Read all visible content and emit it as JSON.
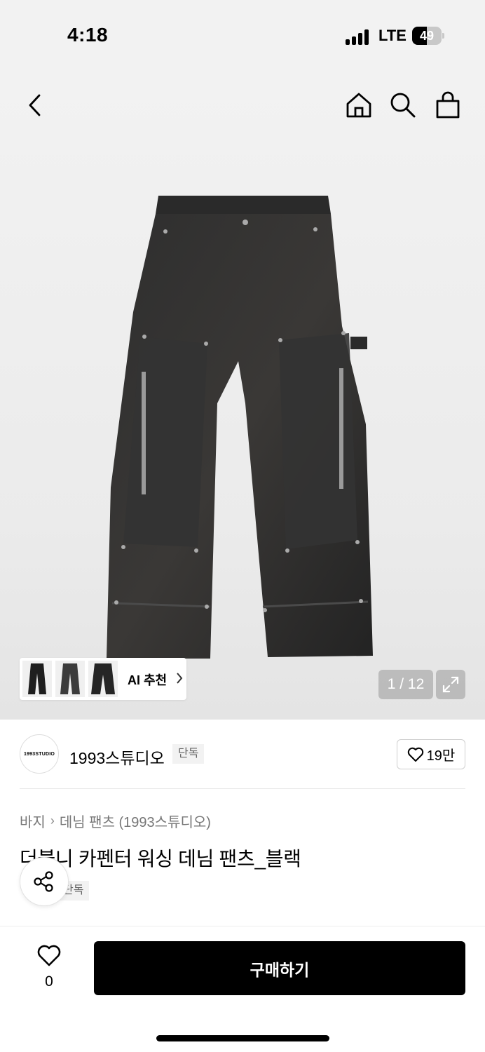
{
  "status": {
    "time": "4:18",
    "network": "LTE",
    "battery": "49",
    "battery_level": 0.49
  },
  "nav": {
    "back_icon": "chevron-left-icon",
    "home_icon": "home-icon",
    "search_icon": "search-icon",
    "cart_icon": "shopping-bag-icon"
  },
  "gallery": {
    "counter": "1 / 12",
    "expand_icon": "expand-icon"
  },
  "ai_recommend": {
    "label": "AI 추천"
  },
  "brand": {
    "logo_text": "1993STUDIO",
    "name": "1993스튜디오",
    "exclusive_tag": "단독",
    "likes": "19만"
  },
  "breadcrumb": {
    "level1": "바지",
    "level2": "데님 팬츠 (1993스튜디오)"
  },
  "product": {
    "title": "더블니 카펜터 워싱 데님 팬츠_블랙",
    "exclusive_tag": "단독"
  },
  "bottom": {
    "wish_count": "0",
    "buy_label": "구매하기"
  },
  "colors": {
    "accent": "#000000",
    "background": "#f2f2f2"
  }
}
